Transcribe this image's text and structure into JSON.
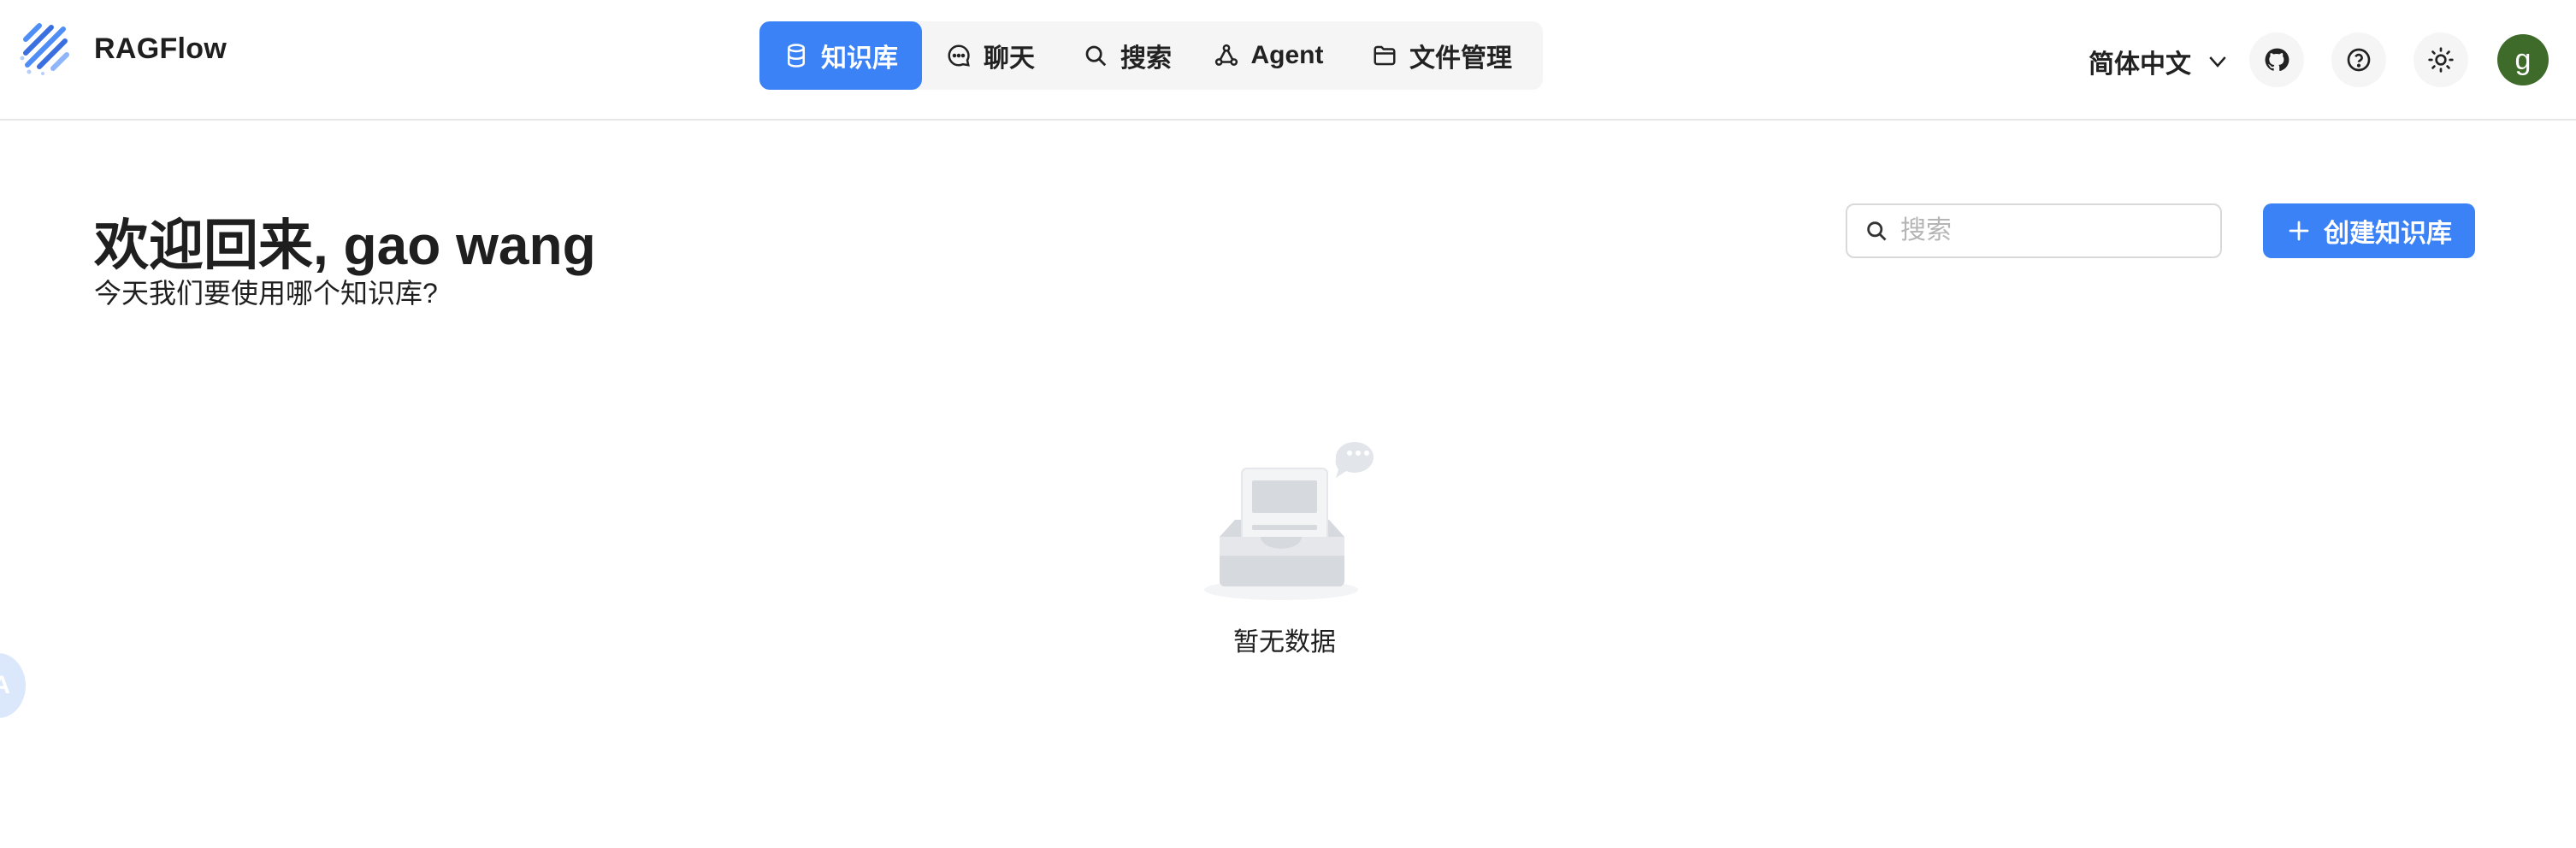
{
  "header": {
    "brand": "RAGFlow",
    "nav": [
      {
        "label": "知识库",
        "icon": "database-icon",
        "active": true
      },
      {
        "label": "聊天",
        "icon": "chat-bubble-icon",
        "active": false
      },
      {
        "label": "搜索",
        "icon": "search-icon",
        "active": false
      },
      {
        "label": "Agent",
        "icon": "agent-graph-icon",
        "active": false
      },
      {
        "label": "文件管理",
        "icon": "folder-icon",
        "active": false
      }
    ],
    "language": "简体中文",
    "avatar_initial": "g",
    "icons": {
      "github": "github-icon",
      "help": "help-circle-icon",
      "theme": "sun-icon",
      "language_dropdown": "chevron-down-icon"
    }
  },
  "main": {
    "welcome_title": "欢迎回来, gao wang",
    "welcome_subtitle": "今天我们要使用哪个知识库?",
    "search_placeholder": "搜索",
    "create_button": "创建知识库",
    "empty_text": "暂无数据"
  },
  "floating_button": {
    "label": "A"
  },
  "colors": {
    "accent": "#3b82f6",
    "avatar_bg": "#3e6b2a",
    "nav_bg": "#f5f5f5",
    "border": "#e6e6e6"
  }
}
